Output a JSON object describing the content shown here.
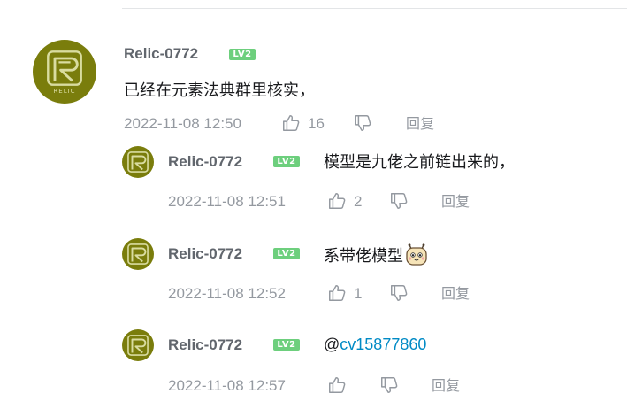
{
  "main_comment": {
    "username": "Relic-0772",
    "level": "LV2",
    "avatar_text": "RELIC",
    "content": "已经在元素法典群里核实，",
    "time": "2022-11-08 12:50",
    "likes": "16",
    "reply_label": "回复"
  },
  "replies": [
    {
      "username": "Relic-0772",
      "level": "LV2",
      "content": "模型是九佬之前链出来的，",
      "time": "2022-11-08 12:51",
      "likes": "2",
      "reply_label": "回复"
    },
    {
      "username": "Relic-0772",
      "level": "LV2",
      "content": "系带佬模型",
      "time": "2022-11-08 12:52",
      "likes": "1",
      "reply_label": "回复"
    },
    {
      "username": "Relic-0772",
      "level": "LV2",
      "content_prefix": "@",
      "content_link": "cv15877860",
      "time": "2022-11-08 12:57",
      "likes": "",
      "reply_label": "回复"
    }
  ],
  "colors": {
    "accent_link": "#008ac5",
    "level_badge": "#6dcf7d",
    "avatar_bg": "#7a7d0c"
  },
  "icons": {
    "like": "thumb-up-icon",
    "dislike": "thumb-down-icon",
    "emoji": "cute-face-emoji-icon"
  }
}
